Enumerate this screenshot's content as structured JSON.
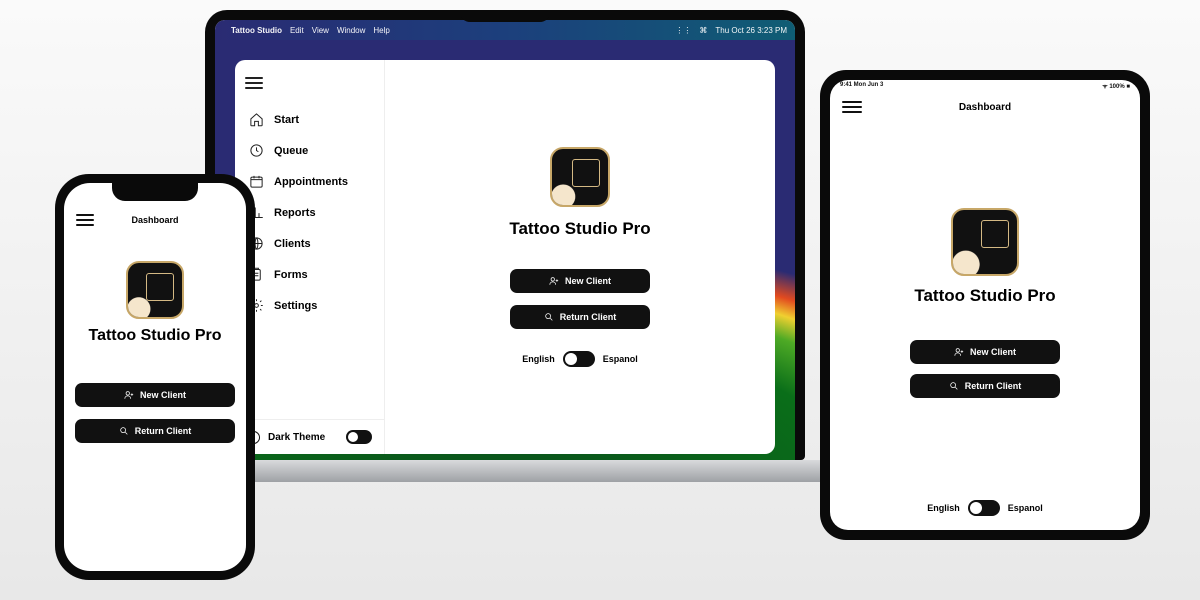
{
  "app_title": "Tattoo Studio Pro",
  "dashboard_label": "Dashboard",
  "menubar": {
    "app": "Tattoo Studio",
    "items": [
      "Edit",
      "View",
      "Window",
      "Help"
    ],
    "clock": "Thu Oct 26  3:23 PM"
  },
  "tablet_status": {
    "time": "9:41  Mon Jun 3",
    "battery": "100%"
  },
  "nav": {
    "items": [
      {
        "label": "Start"
      },
      {
        "label": "Queue"
      },
      {
        "label": "Appointments"
      },
      {
        "label": "Reports"
      },
      {
        "label": "Clients"
      },
      {
        "label": "Forms"
      },
      {
        "label": "Settings"
      }
    ]
  },
  "buttons": {
    "new_client": "New Client",
    "return_client": "Return Client"
  },
  "language": {
    "left": "English",
    "right": "Espanol"
  },
  "theme": {
    "label": "Dark Theme"
  }
}
